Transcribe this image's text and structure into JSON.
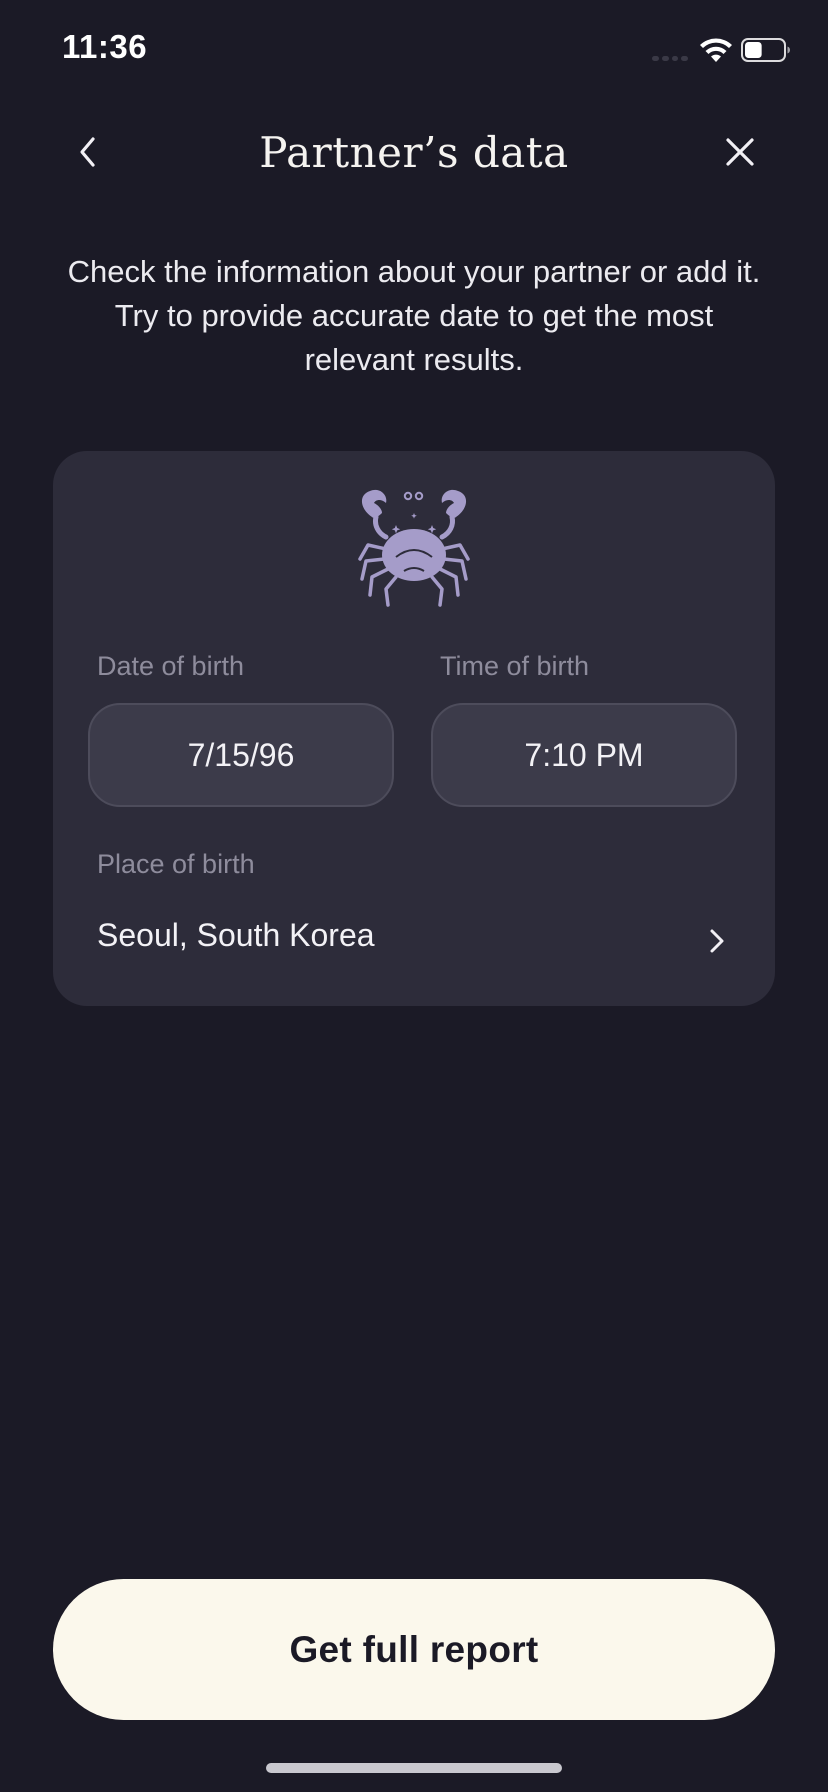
{
  "status_bar": {
    "time": "11:36",
    "battery_level": 0.45
  },
  "nav": {
    "title": "Partner’s data",
    "back_icon": "chevron-left-icon",
    "close_icon": "close-icon"
  },
  "description": "Check the information about your partner or add it. Try to provide accurate date to get the most relevant results.",
  "card": {
    "zodiac_icon": "cancer-crab-icon",
    "date_of_birth": {
      "label": "Date of birth",
      "value": "7/15/96"
    },
    "time_of_birth": {
      "label": "Time of birth",
      "value": "7:10 PM"
    },
    "place_of_birth": {
      "label": "Place of birth",
      "value": "Seoul, South Korea"
    }
  },
  "footer": {
    "button_label": "Get full report"
  },
  "colors": {
    "background": "#1b1a26",
    "card": "#2d2c3a",
    "accent_icon": "#a59cc9",
    "button_bg": "#fbf8ec"
  }
}
